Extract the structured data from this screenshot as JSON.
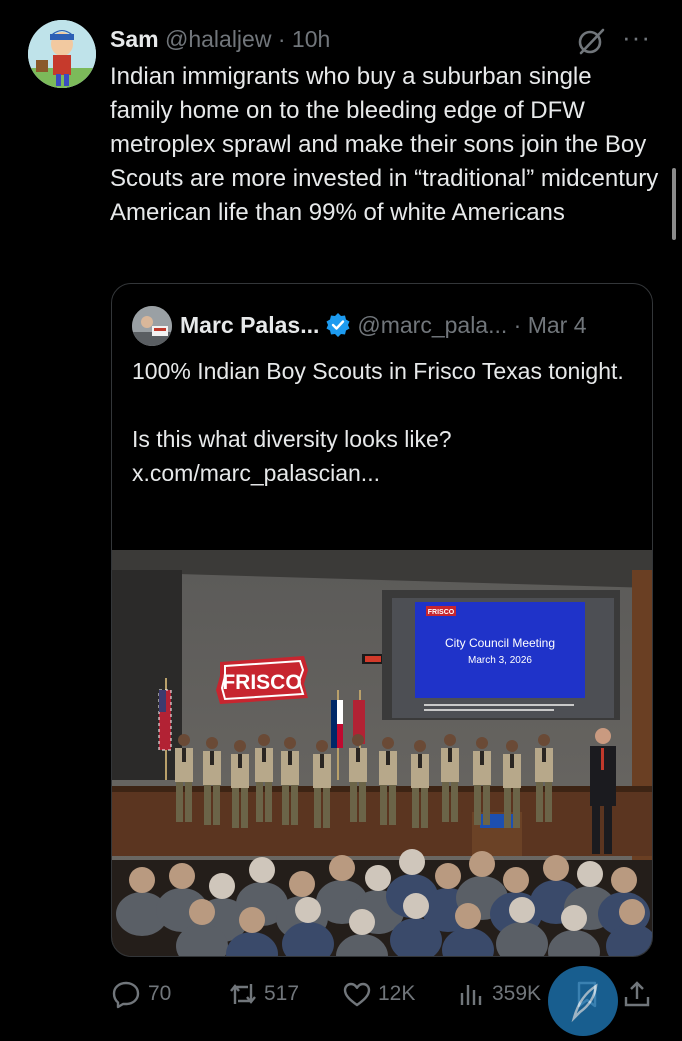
{
  "tweet": {
    "author_name": "Sam",
    "handle": "@halaljew",
    "separator": "·",
    "time": "10h",
    "more": "···",
    "text": "Indian immigrants who buy a suburban single family home on to the bleeding edge of DFW metroplex sprawl and make their sons join the Boy Scouts are more invested in “traditional” midcentury American life than 99% of white Americans"
  },
  "quote": {
    "author_name": "Marc Palas...",
    "handle": "@marc_pala...",
    "separator": "·",
    "date": "Mar 4",
    "line1": "100% Indian Boy Scouts in Frisco Texas tonight.",
    "line2": "Is this what diversity looks like?",
    "link": "x.com/marc_palascian...",
    "photo": {
      "wall_sign": "FRISCO",
      "screen_logo": "FRISCO",
      "screen_title": "City Council Meeting",
      "screen_date": "March 3, 2026"
    }
  },
  "actions": {
    "replies": "70",
    "reposts": "517",
    "likes": "12K",
    "views": "359K"
  },
  "colors": {
    "background": "#000000",
    "text": "#e7e9ea",
    "muted": "#71767b",
    "border": "#333639",
    "verified": "#1d9bf0"
  }
}
